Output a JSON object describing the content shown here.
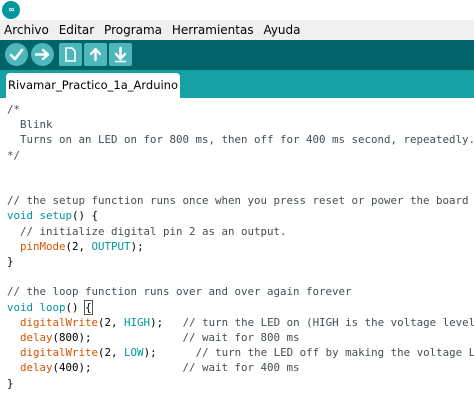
{
  "window": {
    "logo_glyph": "∞"
  },
  "menubar": {
    "items": [
      "Archivo",
      "Editar",
      "Programa",
      "Herramientas",
      "Ayuda"
    ]
  },
  "toolbar": {
    "buttons": [
      {
        "name": "verify",
        "icon": "check-icon"
      },
      {
        "name": "upload",
        "icon": "arrow-right-icon"
      },
      {
        "name": "new",
        "icon": "new-file-icon"
      },
      {
        "name": "open",
        "icon": "arrow-up-icon"
      },
      {
        "name": "save",
        "icon": "arrow-down-icon"
      }
    ]
  },
  "tabs": [
    {
      "label": "Rivamar_Practico_1a_Arduino"
    }
  ],
  "colors": {
    "toolbar": "#006468",
    "tabstrip": "#17a1a5",
    "keyword": "#00979c",
    "function": "#d35400",
    "comment": "#434f54"
  },
  "code": [
    [
      {
        "t": "/*",
        "c": "comment"
      }
    ],
    [
      {
        "t": "  Blink",
        "c": "comment"
      }
    ],
    [
      {
        "t": "  Turns on an LED on for 800 ms, then off for 400 ms second, repeatedly.",
        "c": "comment"
      }
    ],
    [
      {
        "t": "*/",
        "c": "comment"
      }
    ],
    [],
    [],
    [
      {
        "t": "// the setup function runs once when you press reset or power the board",
        "c": "comment"
      }
    ],
    [
      {
        "t": "void",
        "c": "keyword"
      },
      {
        "t": " ",
        "c": "plain"
      },
      {
        "t": "setup",
        "c": "keyword"
      },
      {
        "t": "() {",
        "c": "plain"
      }
    ],
    [
      {
        "t": "  // initialize digital pin 2 as an output.",
        "c": "comment"
      }
    ],
    [
      {
        "t": "  ",
        "c": "plain"
      },
      {
        "t": "pinMode",
        "c": "function"
      },
      {
        "t": "(2, ",
        "c": "plain"
      },
      {
        "t": "OUTPUT",
        "c": "constant"
      },
      {
        "t": ");",
        "c": "plain"
      }
    ],
    [
      {
        "t": "}",
        "c": "plain"
      }
    ],
    [],
    [
      {
        "t": "// the loop function runs over and over again forever",
        "c": "comment"
      }
    ],
    [
      {
        "t": "void",
        "c": "keyword"
      },
      {
        "t": " ",
        "c": "plain"
      },
      {
        "t": "loop",
        "c": "keyword"
      },
      {
        "t": "() ",
        "c": "plain"
      },
      {
        "t": "{",
        "c": "plain",
        "cursor": true
      }
    ],
    [
      {
        "t": "  ",
        "c": "plain"
      },
      {
        "t": "digitalWrite",
        "c": "function"
      },
      {
        "t": "(2, ",
        "c": "plain"
      },
      {
        "t": "HIGH",
        "c": "constant"
      },
      {
        "t": ");   ",
        "c": "plain"
      },
      {
        "t": "// turn the LED on (HIGH is the voltage level)",
        "c": "comment"
      }
    ],
    [
      {
        "t": "  ",
        "c": "plain"
      },
      {
        "t": "delay",
        "c": "function"
      },
      {
        "t": "(800);              ",
        "c": "plain"
      },
      {
        "t": "// wait for 800 ms",
        "c": "comment"
      }
    ],
    [
      {
        "t": "  ",
        "c": "plain"
      },
      {
        "t": "digitalWrite",
        "c": "function"
      },
      {
        "t": "(2, ",
        "c": "plain"
      },
      {
        "t": "LOW",
        "c": "constant"
      },
      {
        "t": ");      ",
        "c": "plain"
      },
      {
        "t": "// turn the LED off by making the voltage LOW",
        "c": "comment"
      }
    ],
    [
      {
        "t": "  ",
        "c": "plain"
      },
      {
        "t": "delay",
        "c": "function"
      },
      {
        "t": "(400);              ",
        "c": "plain"
      },
      {
        "t": "// wait for 400 ms",
        "c": "comment"
      }
    ],
    [
      {
        "t": "}",
        "c": "plain"
      }
    ]
  ]
}
